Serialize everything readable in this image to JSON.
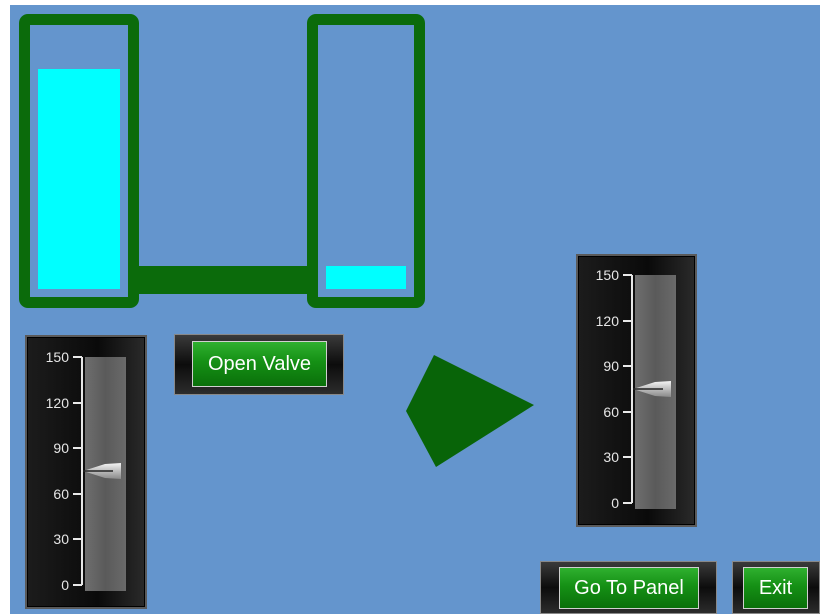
{
  "colors": {
    "background": "#6495cd",
    "tank_frame": "#0b6b0b",
    "liquid": "#00ffff",
    "button_green": "#159015",
    "arrow": "#086408"
  },
  "tanks": {
    "left": {
      "level_fraction": 0.86
    },
    "right": {
      "level_fraction": 0.09
    }
  },
  "gauges": {
    "left": {
      "value": 75,
      "min": 0,
      "max": 150,
      "ticks": [
        "150",
        "120",
        "90",
        "60",
        "30",
        "0"
      ]
    },
    "right": {
      "value": 75,
      "min": 0,
      "max": 150,
      "ticks": [
        "150",
        "120",
        "90",
        "60",
        "30",
        "0"
      ]
    }
  },
  "buttons": {
    "open_valve": "Open Valve",
    "go_to_panel": "Go To Panel",
    "exit": "Exit"
  },
  "icons": {
    "flow_arrow": "flow-direction-arrow-icon"
  }
}
